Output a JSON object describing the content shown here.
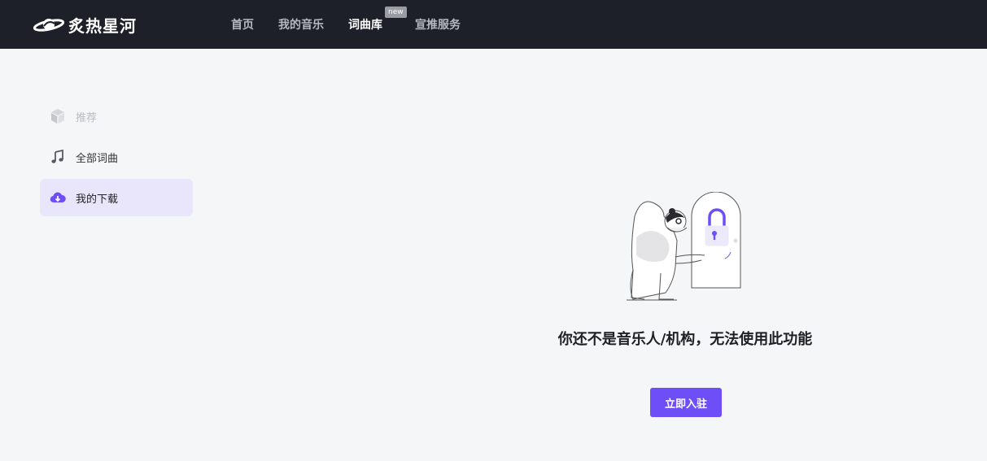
{
  "brand": {
    "name": "炙热星河"
  },
  "nav": {
    "items": [
      {
        "label": "首页"
      },
      {
        "label": "我的音乐"
      },
      {
        "label": "词曲库",
        "badge": "new",
        "active": true
      },
      {
        "label": "宣推服务"
      }
    ]
  },
  "sidebar": {
    "items": [
      {
        "label": "推荐",
        "icon": "cube-icon",
        "state": "disabled"
      },
      {
        "label": "全部词曲",
        "icon": "music-note-icon",
        "state": "normal"
      },
      {
        "label": "我的下载",
        "icon": "cloud-download-icon",
        "state": "active"
      }
    ]
  },
  "main": {
    "message": "你还不是音乐人/机构，无法使用此功能",
    "button_label": "立即入驻"
  },
  "colors": {
    "topbar": "#1e2029",
    "accent": "#6d4ef7",
    "active_bg": "#e9e6fb",
    "page_bg": "#f5f6f8"
  }
}
